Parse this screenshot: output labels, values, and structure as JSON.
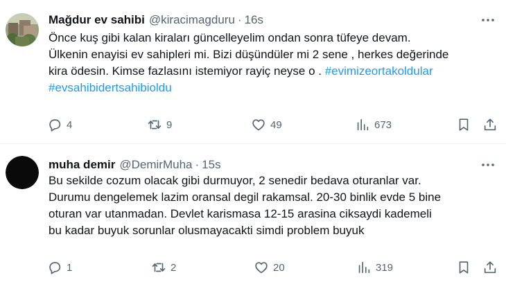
{
  "tweets": [
    {
      "display_name": "Mağdur ev sahibi",
      "handle": "@kiracimagduru",
      "separator": "·",
      "time": "16s",
      "avatar_icon": "profile-photo",
      "lines": [
        "Önce kuş gibi kalan kiraları güncelleyelim ondan sonra tüfeye devam.",
        "Ülkenin enayisi ev sahipleri mi. Bizi düşündüler mi 2 sene , herkes değerinde",
        "kira ödesin. Kimse fazlasını istemiyor rayiç neyse o . "
      ],
      "hashtags": [
        "#evimizeortakoldular",
        "#evsahibidertsahibioldu"
      ],
      "replies": "4",
      "retweets": "9",
      "likes": "49",
      "views": "673"
    },
    {
      "display_name": "muha demir",
      "handle": "@DemirMuha",
      "separator": "·",
      "time": "15s",
      "avatar_icon": "default-black-avatar",
      "lines": [
        "Bu sekilde cozum olacak gibi durmuyor, 2 senedir bedava oturanlar var.",
        "Durumu dengelemek lazim oransal degil rakamsal. 20-30 binlik evde 5 bine",
        "oturan var utanmadan. Devlet karismasa 12-15 arasina ciksaydi kademeli",
        "bu kadar buyuk sorunlar olusmayacakti simdi problem buyuk"
      ],
      "replies": "1",
      "retweets": "2",
      "likes": "20",
      "views": "319"
    }
  ],
  "colors": {
    "text": "#0f1419",
    "secondary": "#536471",
    "link": "#1d9bf0",
    "divider": "#eff3f4"
  }
}
